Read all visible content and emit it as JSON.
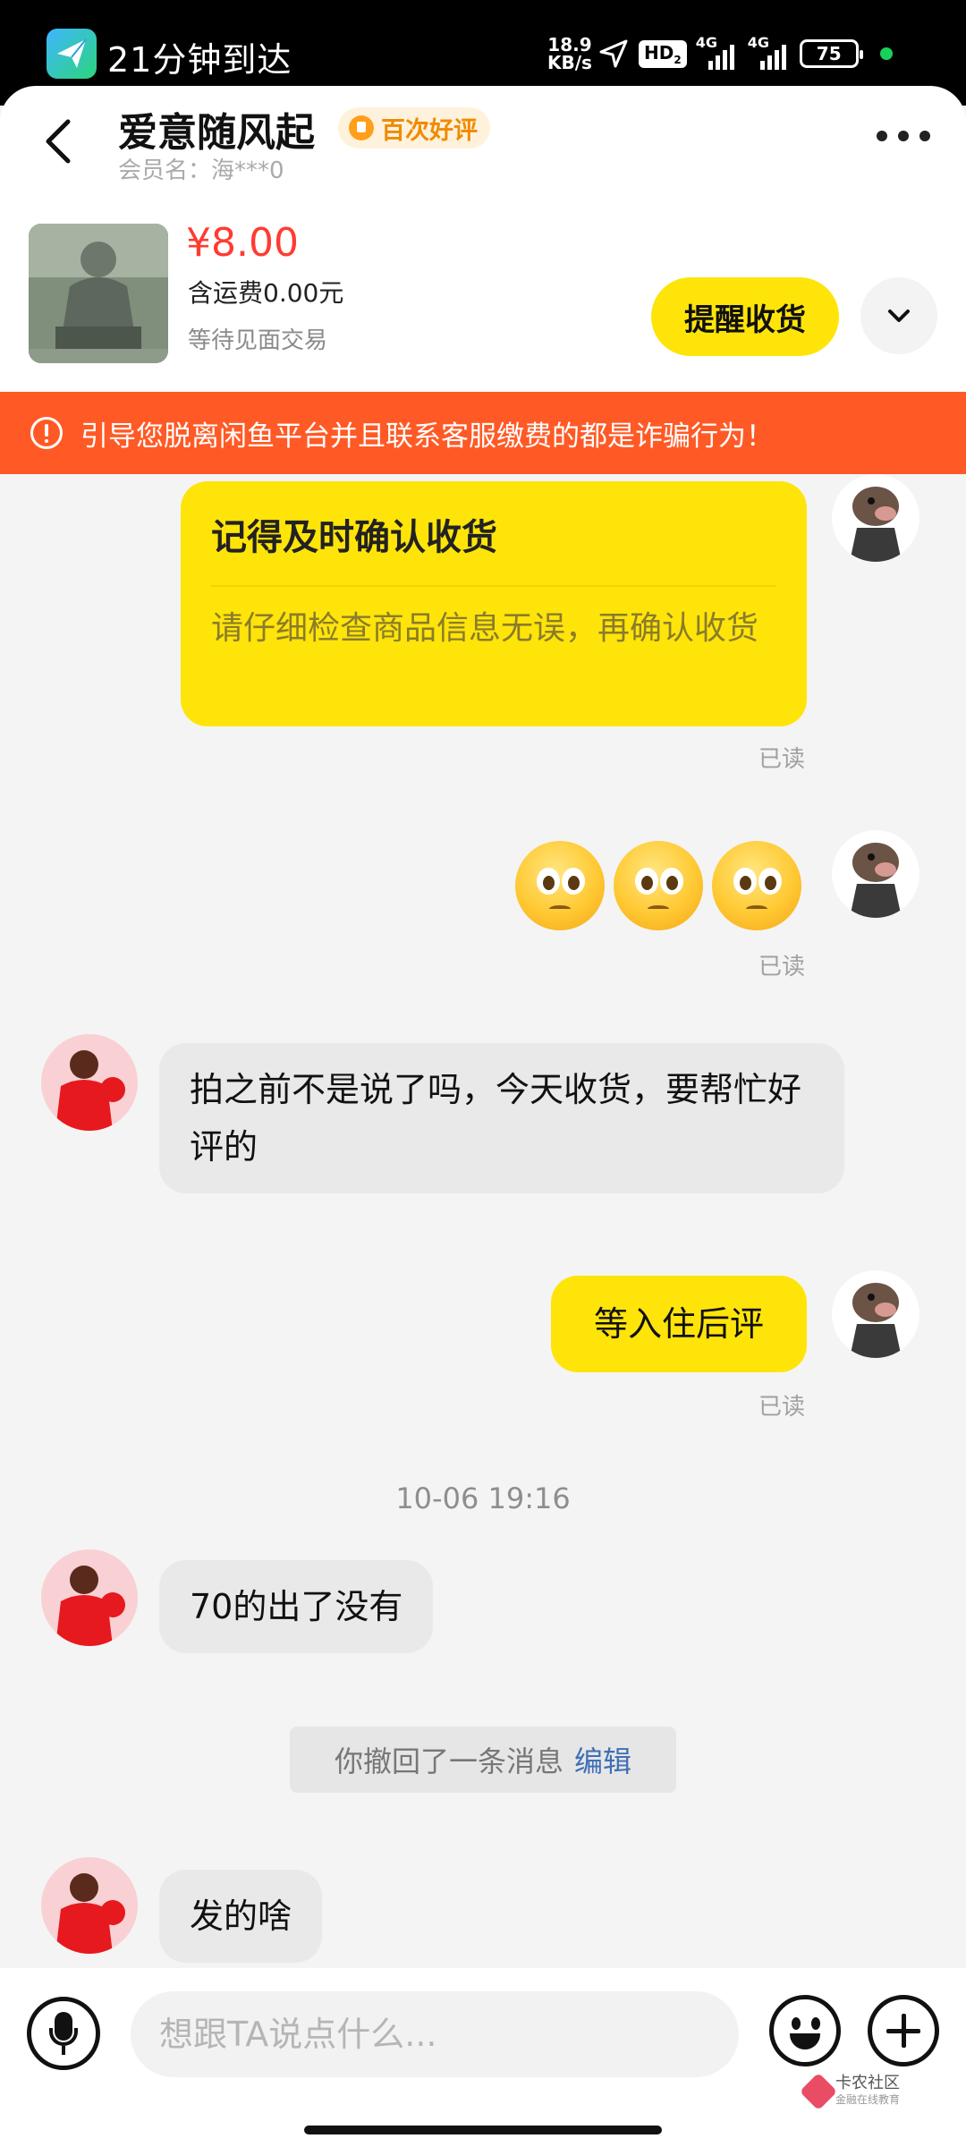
{
  "status_bar": {
    "app_title": "21分钟到达",
    "net_speed_value": "18.9",
    "net_speed_unit": "KB/s",
    "hd_badge": "HD",
    "hd_sub": "2",
    "signal_1_label": "4G",
    "signal_2_label": "4G",
    "battery": "75",
    "icons": [
      "send-icon",
      "location-arrow-icon",
      "signal-icon",
      "battery-icon",
      "dot-indicator"
    ]
  },
  "header": {
    "contact_name": "爱意随风起",
    "badge_label": "百次好评",
    "member_label": "会员名：海***0",
    "product": {
      "price": "¥8.00",
      "shipping": "含运费0.00元",
      "status": "等待见面交易"
    },
    "remind_button": "提醒收货"
  },
  "warning_banner": "引导您脱离闲鱼平台并且联系客服缴费的都是诈骗行为！",
  "messages": {
    "confirm_card_title": "记得及时确认收货",
    "confirm_card_body": "请仔细检查商品信息无误，再确认收货",
    "read_label": "已读",
    "other_msg_1": "拍之前不是说了吗，今天收货，要帮忙好评的",
    "me_msg_1": "等入住后评",
    "timestamp": "10-06 19:16",
    "other_msg_2": "70的出了没有",
    "recall_text": "你撤回了一条消息",
    "recall_edit": "编辑",
    "other_msg_3": "发的啥"
  },
  "input_bar": {
    "placeholder": "想跟TA说点什么..."
  },
  "watermark": {
    "name": "卡农社区",
    "sub": "金融在线教育"
  },
  "colors": {
    "accent_yellow": "#ffe40a",
    "warning_orange": "#ff5a26",
    "price_red": "#ff3b30"
  }
}
